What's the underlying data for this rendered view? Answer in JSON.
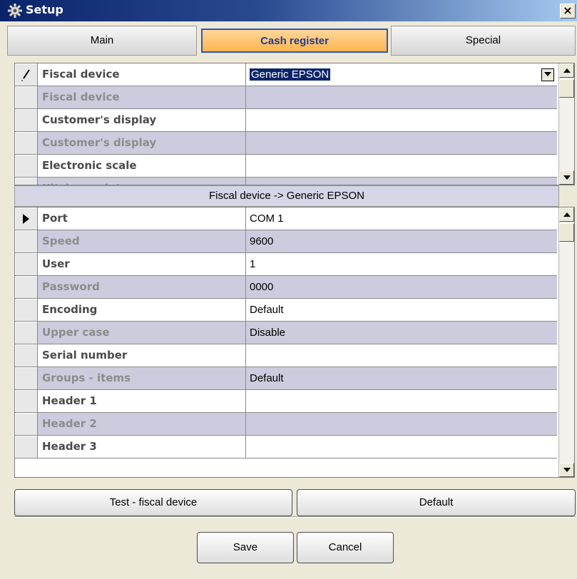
{
  "window": {
    "title": "Setup",
    "close_glyph": "×"
  },
  "tabs": [
    {
      "label": "Main",
      "active": false
    },
    {
      "label": "Cash register",
      "active": true
    },
    {
      "label": "Special",
      "active": false
    }
  ],
  "device_grid": {
    "rows": [
      {
        "label": "Fiscal device",
        "value": "Generic EPSON"
      },
      {
        "label": "Fiscal device",
        "value": ""
      },
      {
        "label": "Customer's display",
        "value": ""
      },
      {
        "label": "Customer's display",
        "value": ""
      },
      {
        "label": "Electronic scale",
        "value": ""
      },
      {
        "label": "Kitchen printer",
        "value": ""
      }
    ]
  },
  "section_header": "Fiscal device -> Generic EPSON",
  "settings_grid": {
    "rows": [
      {
        "label": "Port",
        "value": "COM 1"
      },
      {
        "label": "Speed",
        "value": "9600"
      },
      {
        "label": "User",
        "value": "1"
      },
      {
        "label": "Password",
        "value": "0000"
      },
      {
        "label": "Encoding",
        "value": "Default"
      },
      {
        "label": "Upper case",
        "value": "Disable"
      },
      {
        "label": "Serial number",
        "value": ""
      },
      {
        "label": "Groups - items",
        "value": "Default"
      },
      {
        "label": "Header 1",
        "value": ""
      },
      {
        "label": "Header 2",
        "value": ""
      },
      {
        "label": "Header 3",
        "value": ""
      }
    ]
  },
  "buttons": {
    "test_fiscal": "Test - fiscal device",
    "default": "Default",
    "save": "Save",
    "cancel": "Cancel"
  },
  "colors": {
    "title_bar": "#0a246a",
    "active_tab": "#ffb450",
    "row_alt": "#ccccde"
  }
}
